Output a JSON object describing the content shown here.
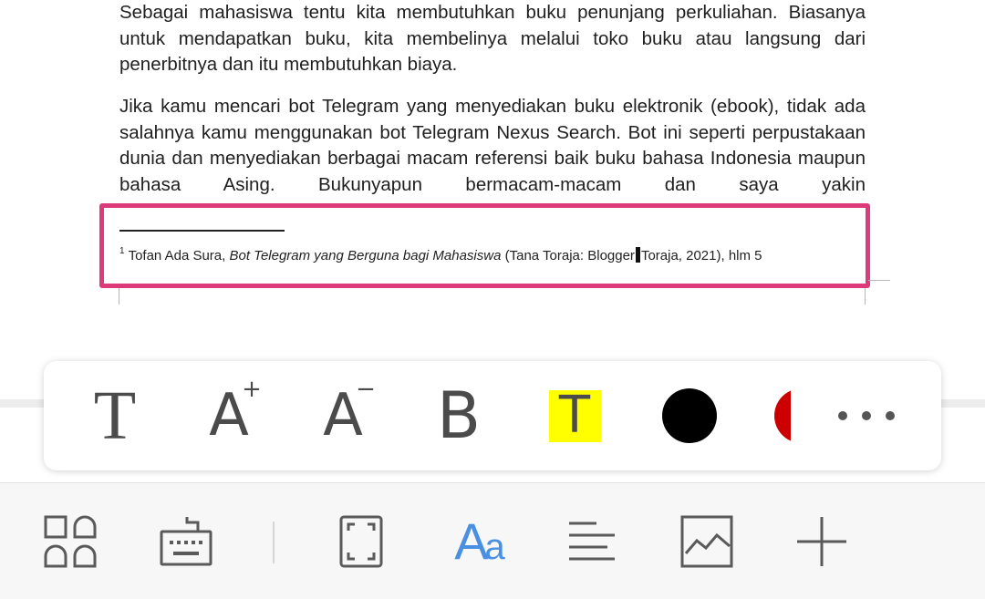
{
  "document": {
    "paragraph1": "Sebagai mahasiswa tentu kita membutuhkan buku penunjang perkuliahan. Biasanya untuk mendapatkan buku, kita membelinya melalui toko buku atau langsung dari penerbitnya dan itu membutuhkan biaya.",
    "paragraph2": "Jika kamu mencari bot Telegram yang menyediakan buku elektronik (ebook), tidak ada salahnya kamu menggunakan bot Telegram Nexus Search. Bot ini seperti perpustakaan dunia dan menyediakan berbagai macam referensi baik buku bahasa Indonesia maupun bahasa Asing. Bukunyapun bermacam-macam dan saya yakin",
    "footnote": {
      "number": "1",
      "author": "Tofan Ada Sura, ",
      "title": "Bot Telegram yang Berguna bagi Mahasiswa",
      "publisher_before_cursor": " (Tana Toraja: Blogger",
      "publisher_after_cursor": "Toraja, 2021), hlm 5"
    }
  },
  "format_toolbar": {
    "text_style_glyph": "T",
    "size_up_glyph": "A",
    "size_up_mark": "+",
    "size_down_glyph": "A",
    "size_down_mark": "−",
    "bold_glyph": "B",
    "highlight_glyph": "T",
    "colors": {
      "highlight": "#ffff00",
      "font_color": "#000000",
      "next_color": "#cc0000",
      "annotation_box": "#dc3a7a",
      "accent": "#4a90e2"
    }
  },
  "bottom_bar": {
    "font_label_big": "A",
    "font_label_small": "a",
    "icons": [
      "layout-grid-icon",
      "keyboard-icon",
      "fullscreen-icon",
      "font-icon",
      "align-icon",
      "image-icon",
      "add-icon"
    ]
  }
}
